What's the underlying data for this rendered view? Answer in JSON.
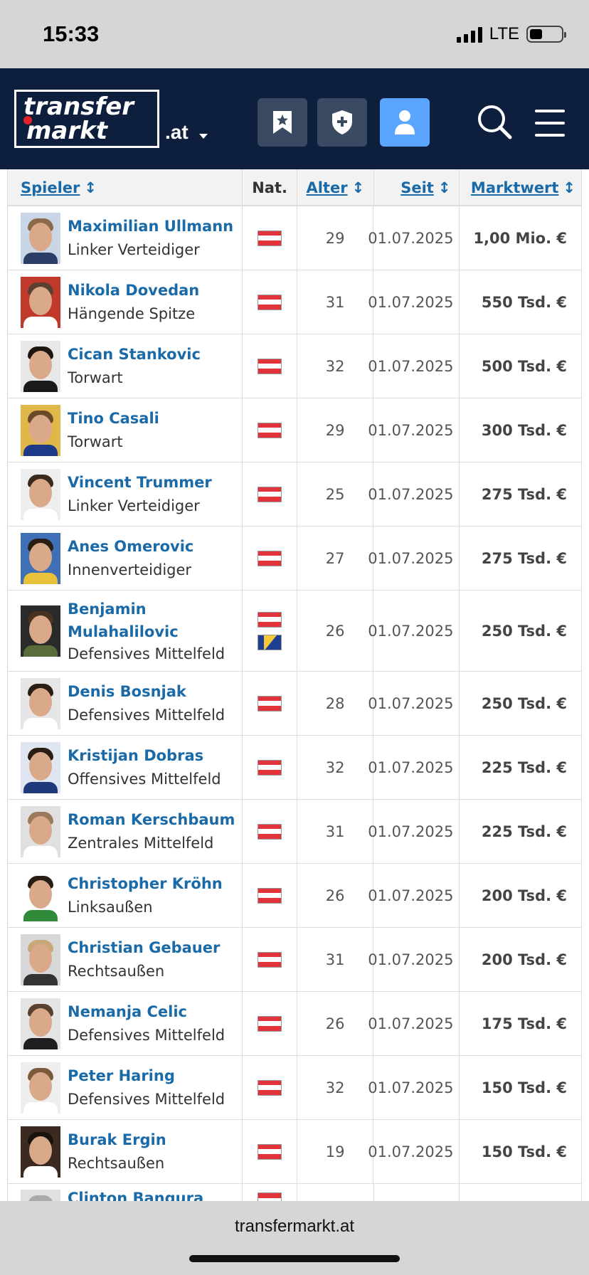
{
  "status_bar": {
    "time": "15:33",
    "network": "LTE"
  },
  "header": {
    "logo_line1": "transfer",
    "logo_line2": "markt",
    "domain": ".at",
    "buttons": [
      "watchlist-button",
      "club-button",
      "profile-button"
    ]
  },
  "table": {
    "columns": {
      "player": "Spieler",
      "nationality": "Nat.",
      "age": "Alter",
      "since": "Seit",
      "value": "Marktwert"
    },
    "sort_glyph": "↕",
    "rows": [
      {
        "name": "Maximilian Ullmann",
        "position": "Linker Verteidiger",
        "age": "29",
        "since": "01.07.2025",
        "value": "1,00 Mio. €",
        "flags": [
          "austria"
        ]
      },
      {
        "name": "Nikola Dovedan",
        "position": "Hängende Spitze",
        "age": "31",
        "since": "01.07.2025",
        "value": "550 Tsd. €",
        "flags": [
          "austria"
        ]
      },
      {
        "name": "Cican Stankovic",
        "position": "Torwart",
        "age": "32",
        "since": "01.07.2025",
        "value": "500 Tsd. €",
        "flags": [
          "austria"
        ]
      },
      {
        "name": "Tino Casali",
        "position": "Torwart",
        "age": "29",
        "since": "01.07.2025",
        "value": "300 Tsd. €",
        "flags": [
          "austria"
        ]
      },
      {
        "name": "Vincent Trummer",
        "position": "Linker Verteidiger",
        "age": "25",
        "since": "01.07.2025",
        "value": "275 Tsd. €",
        "flags": [
          "austria"
        ]
      },
      {
        "name": "Anes Omerovic",
        "position": "Innenverteidiger",
        "age": "27",
        "since": "01.07.2025",
        "value": "275 Tsd. €",
        "flags": [
          "austria"
        ]
      },
      {
        "name": "Benjamin Mulahalilovic",
        "name_line1": "Benjamin",
        "name_line2": "Mulahalilovic",
        "position": "Defensives Mittelfeld",
        "age": "26",
        "since": "01.07.2025",
        "value": "250 Tsd. €",
        "flags": [
          "austria",
          "bosnia"
        ]
      },
      {
        "name": "Denis Bosnjak",
        "position": "Defensives Mittelfeld",
        "age": "28",
        "since": "01.07.2025",
        "value": "250 Tsd. €",
        "flags": [
          "austria"
        ]
      },
      {
        "name": "Kristijan Dobras",
        "position": "Offensives Mittelfeld",
        "age": "32",
        "since": "01.07.2025",
        "value": "225 Tsd. €",
        "flags": [
          "austria"
        ]
      },
      {
        "name": "Roman Kerschbaum",
        "position": "Zentrales Mittelfeld",
        "age": "31",
        "since": "01.07.2025",
        "value": "225 Tsd. €",
        "flags": [
          "austria"
        ]
      },
      {
        "name": "Christopher Kröhn",
        "position": "Linksaußen",
        "age": "26",
        "since": "01.07.2025",
        "value": "200 Tsd. €",
        "flags": [
          "austria"
        ]
      },
      {
        "name": "Christian Gebauer",
        "position": "Rechtsaußen",
        "age": "31",
        "since": "01.07.2025",
        "value": "200 Tsd. €",
        "flags": [
          "austria"
        ]
      },
      {
        "name": "Nemanja Celic",
        "position": "Defensives Mittelfeld",
        "age": "26",
        "since": "01.07.2025",
        "value": "175 Tsd. €",
        "flags": [
          "austria"
        ]
      },
      {
        "name": "Peter Haring",
        "position": "Defensives Mittelfeld",
        "age": "32",
        "since": "01.07.2025",
        "value": "150 Tsd. €",
        "flags": [
          "austria"
        ]
      },
      {
        "name": "Burak Ergin",
        "position": "Rechtsaußen",
        "age": "19",
        "since": "01.07.2025",
        "value": "150 Tsd. €",
        "flags": [
          "austria"
        ]
      },
      {
        "name": "Clinton Bangura",
        "partial": true,
        "flags": [
          "austria"
        ]
      }
    ]
  },
  "browser": {
    "url": "transfermarkt.at"
  },
  "colors": {
    "navbar": "#0e1e3d",
    "link": "#1a6aa8",
    "active_button": "#5aa6ff"
  }
}
